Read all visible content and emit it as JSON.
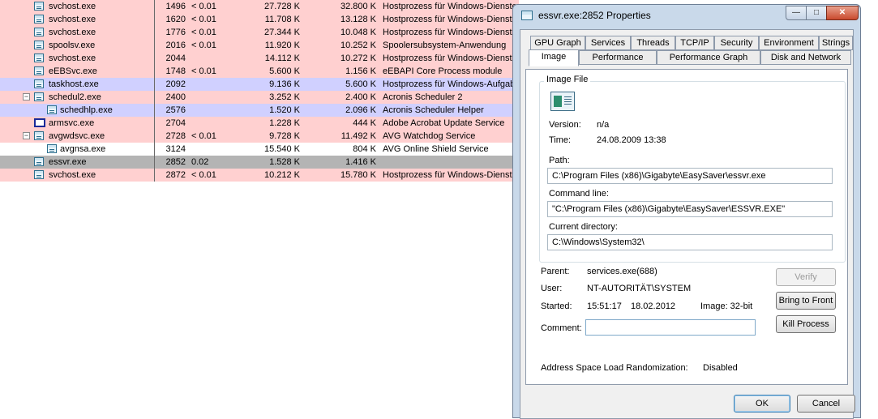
{
  "processes": [
    {
      "name": "svchost.exe",
      "pid": "1496",
      "cpu": "< 0.01",
      "private": "27.728 K",
      "working": "32.800 K",
      "desc": "Hostprozess für Windows-Dienste",
      "style": "pink"
    },
    {
      "name": "svchost.exe",
      "pid": "1620",
      "cpu": "< 0.01",
      "private": "11.708 K",
      "working": "13.128 K",
      "desc": "Hostprozess für Windows-Dienste",
      "style": "pink"
    },
    {
      "name": "svchost.exe",
      "pid": "1776",
      "cpu": "< 0.01",
      "private": "27.344 K",
      "working": "10.048 K",
      "desc": "Hostprozess für Windows-Dienste",
      "style": "pink"
    },
    {
      "name": "spoolsv.exe",
      "pid": "2016",
      "cpu": "< 0.01",
      "private": "11.920 K",
      "working": "10.252 K",
      "desc": "Spoolersubsystem-Anwendung",
      "style": "pink"
    },
    {
      "name": "svchost.exe",
      "pid": "2044",
      "cpu": "",
      "private": "14.112 K",
      "working": "10.272 K",
      "desc": "Hostprozess für Windows-Dienste",
      "style": "pink"
    },
    {
      "name": "eEBSvc.exe",
      "pid": "1748",
      "cpu": "< 0.01",
      "private": "5.600 K",
      "working": "1.156 K",
      "desc": "eEBAPI Core Process module",
      "style": "pink"
    },
    {
      "name": "taskhost.exe",
      "pid": "2092",
      "cpu": "",
      "private": "9.136 K",
      "working": "5.600 K",
      "desc": "Hostprozess für Windows-Aufgaben",
      "style": "lav"
    },
    {
      "name": "schedul2.exe",
      "pid": "2400",
      "cpu": "",
      "private": "3.252 K",
      "working": "2.400 K",
      "desc": "Acronis Scheduler 2",
      "style": "pink",
      "expander": "−"
    },
    {
      "name": "schedhlp.exe",
      "pid": "2576",
      "cpu": "",
      "private": "1.520 K",
      "working": "2.096 K",
      "desc": "Acronis Scheduler Helper",
      "style": "lav",
      "child": true
    },
    {
      "name": "armsvc.exe",
      "pid": "2704",
      "cpu": "",
      "private": "1.228 K",
      "working": "444 K",
      "desc": "Adobe Acrobat Update Service",
      "style": "pink",
      "blankicon": true
    },
    {
      "name": "avgwdsvc.exe",
      "pid": "2728",
      "cpu": "< 0.01",
      "private": "9.728 K",
      "working": "11.492 K",
      "desc": "AVG Watchdog Service",
      "style": "pink",
      "expander": "−"
    },
    {
      "name": "avgnsa.exe",
      "pid": "3124",
      "cpu": "",
      "private": "15.540 K",
      "working": "804 K",
      "desc": "AVG Online Shield Service",
      "style": "white",
      "child": true
    },
    {
      "name": "essvr.exe",
      "pid": "2852",
      "cpu": "0.02",
      "private": "1.528 K",
      "working": "1.416 K",
      "desc": "",
      "style": "sel"
    },
    {
      "name": "svchost.exe",
      "pid": "2872",
      "cpu": "< 0.01",
      "private": "10.212 K",
      "working": "15.780 K",
      "desc": "Hostprozess für Windows-Dienste",
      "style": "pink"
    }
  ],
  "dialog": {
    "title": "essvr.exe:2852 Properties",
    "window_buttons": {
      "minimize": "—",
      "maximize": "□",
      "close": "✕"
    },
    "tabs_row1": [
      "GPU Graph",
      "Services",
      "Threads",
      "TCP/IP",
      "Security",
      "Environment",
      "Strings"
    ],
    "tabs_row2": [
      "Image",
      "Performance",
      "Performance Graph",
      "Disk and Network"
    ],
    "active_tab": "Image",
    "image_file": {
      "legend": "Image File",
      "version_label": "Version:",
      "version": "n/a",
      "time_label": "Time:",
      "time": "24.08.2009 13:38",
      "path_label": "Path:",
      "path": "C:\\Program Files (x86)\\Gigabyte\\EasySaver\\essvr.exe",
      "cmdline_label": "Command line:",
      "cmdline": "\"C:\\Program Files (x86)\\Gigabyte\\EasySaver\\ESSVR.EXE\"",
      "curdir_label": "Current directory:",
      "curdir": "C:\\Windows\\System32\\"
    },
    "parent_label": "Parent:",
    "parent": "services.exe(688)",
    "user_label": "User:",
    "user": "NT-AUTORITÄT\\SYSTEM",
    "started_label": "Started:",
    "started_time": "15:51:17",
    "started_date": "18.02.2012",
    "image_bits": "Image: 32-bit",
    "comment_label": "Comment:",
    "comment": "",
    "aslr_label": "Address Space Load Randomization:",
    "aslr_value": "Disabled",
    "buttons": {
      "verify": "Verify",
      "bring_to_front": "Bring to Front",
      "kill": "Kill Process",
      "ok": "OK",
      "cancel": "Cancel"
    }
  }
}
